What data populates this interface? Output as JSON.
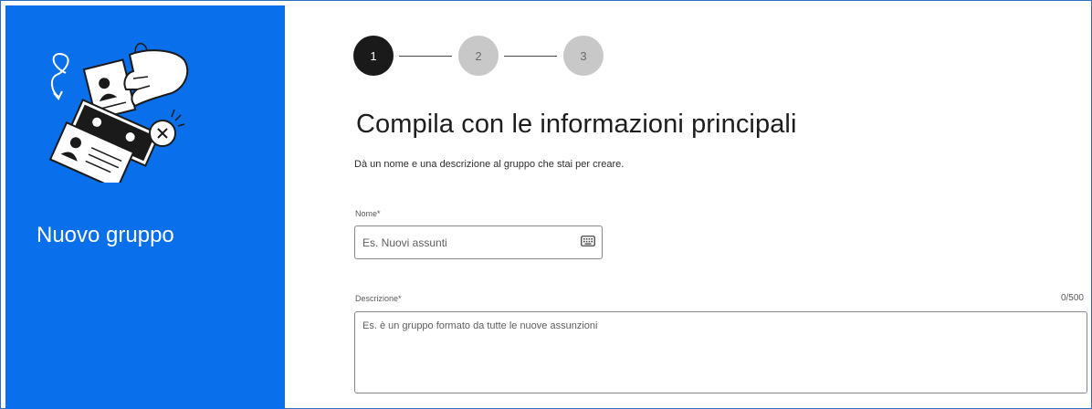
{
  "colors": {
    "sidebar_bg": "#0a6fea",
    "step_active": "#1a1a1a",
    "step_inactive": "#c8c8c8"
  },
  "sidebar": {
    "illustration_icon": "id-cards-hand-illustration",
    "title": "Nuovo gruppo"
  },
  "stepper": {
    "steps": [
      {
        "label": "1",
        "state": "active"
      },
      {
        "label": "2",
        "state": "inactive"
      },
      {
        "label": "3",
        "state": "inactive"
      }
    ]
  },
  "main": {
    "title": "Compila con le informazioni principali",
    "subtitle": "Dà un nome e una descrizione al gruppo che stai per creare."
  },
  "form": {
    "name": {
      "label": "Nome*",
      "placeholder": "Es. Nuovi assunti",
      "value": "",
      "icon": "keyboard-icon"
    },
    "description": {
      "label": "Descrizione*",
      "placeholder": "Es. è un gruppo formato da tutte le nuove assunzioni",
      "value": "",
      "counter": "0/500"
    }
  }
}
